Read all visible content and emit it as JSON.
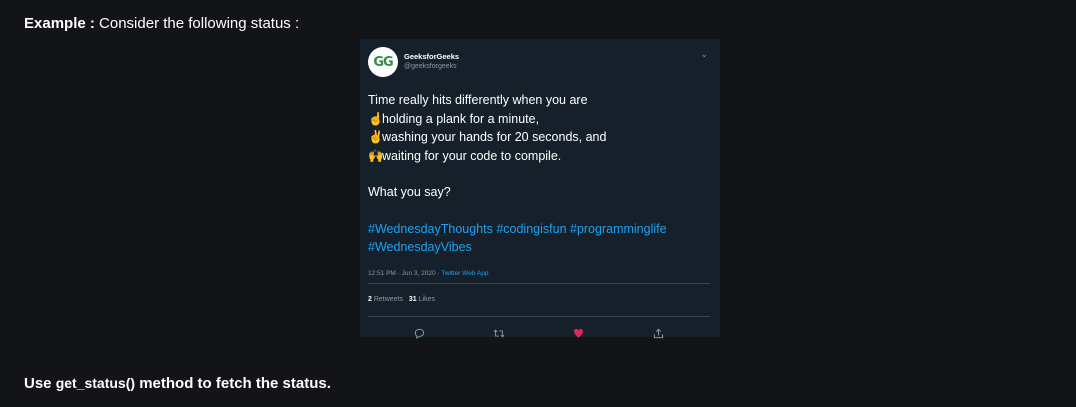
{
  "intro": {
    "lead": "Example : ",
    "text": "Consider the following status :"
  },
  "tweet": {
    "avatar_text": "GG",
    "display_name": "GeeksforGeeks",
    "handle": "@geeksforgeeks",
    "lines": [
      {
        "emoji": "",
        "text": "Time really hits differently when you are"
      },
      {
        "emoji": "☝",
        "text": "holding a plank for a minute,"
      },
      {
        "emoji": "✌",
        "text": "washing your hands for 20 seconds, and"
      },
      {
        "emoji": "🙌",
        "text": "waiting for your code to compile."
      }
    ],
    "question": "What you say?",
    "hashtags_line1": "#WednesdayThoughts #codingisfun #programminglife",
    "hashtags_line2": "#WednesdayVibes",
    "timestamp": "12:51 PM · Jun 3, 2020 · ",
    "source": "Twitter Web App",
    "retweets_count": "2",
    "retweets_label": "Retweets",
    "likes_count": "31",
    "likes_label": "Likes"
  },
  "outro": {
    "before": "Use ",
    "code": "get_status()",
    "after": " method to fetch the status."
  },
  "colors": {
    "background": "#131417",
    "tweet_bg": "#15202b",
    "link": "#1da1f2",
    "like": "#e0245e"
  }
}
